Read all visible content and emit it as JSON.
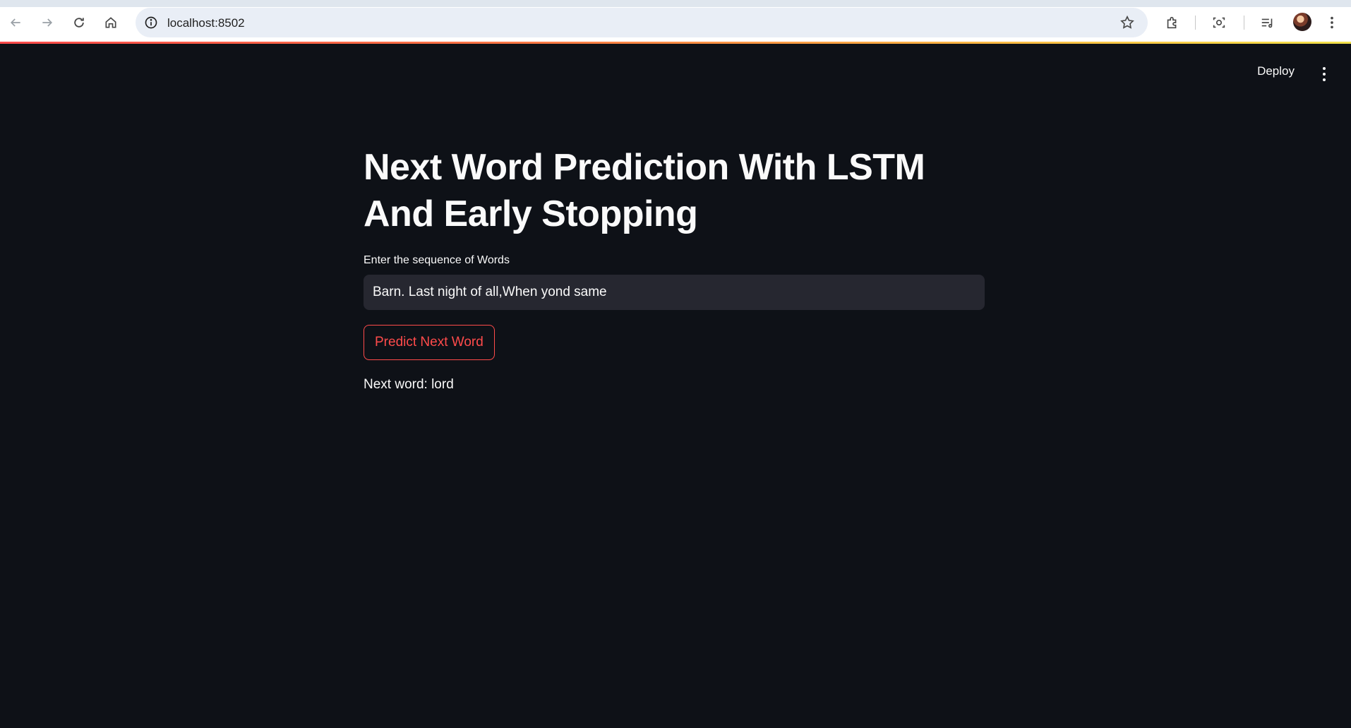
{
  "browser": {
    "url": "localhost:8502",
    "icons": [
      "back-icon",
      "forward-icon",
      "reload-icon",
      "home-icon",
      "site-info-icon",
      "bookmark-star-icon",
      "extensions-icon",
      "screenshot-icon",
      "media-controls-icon",
      "kebab-menu-icon"
    ]
  },
  "app": {
    "deploy_label": "Deploy",
    "title": "Next Word Prediction With LSTM And Early Stopping",
    "input": {
      "label": "Enter the sequence of Words",
      "value": "Barn. Last night of all,When yond same"
    },
    "predict_button_label": "Predict Next Word",
    "result": "Next word: lord",
    "colors": {
      "background": "#0e1117",
      "input_background": "#262730",
      "accent": "#ff4b4b",
      "text": "#fafafa"
    }
  }
}
